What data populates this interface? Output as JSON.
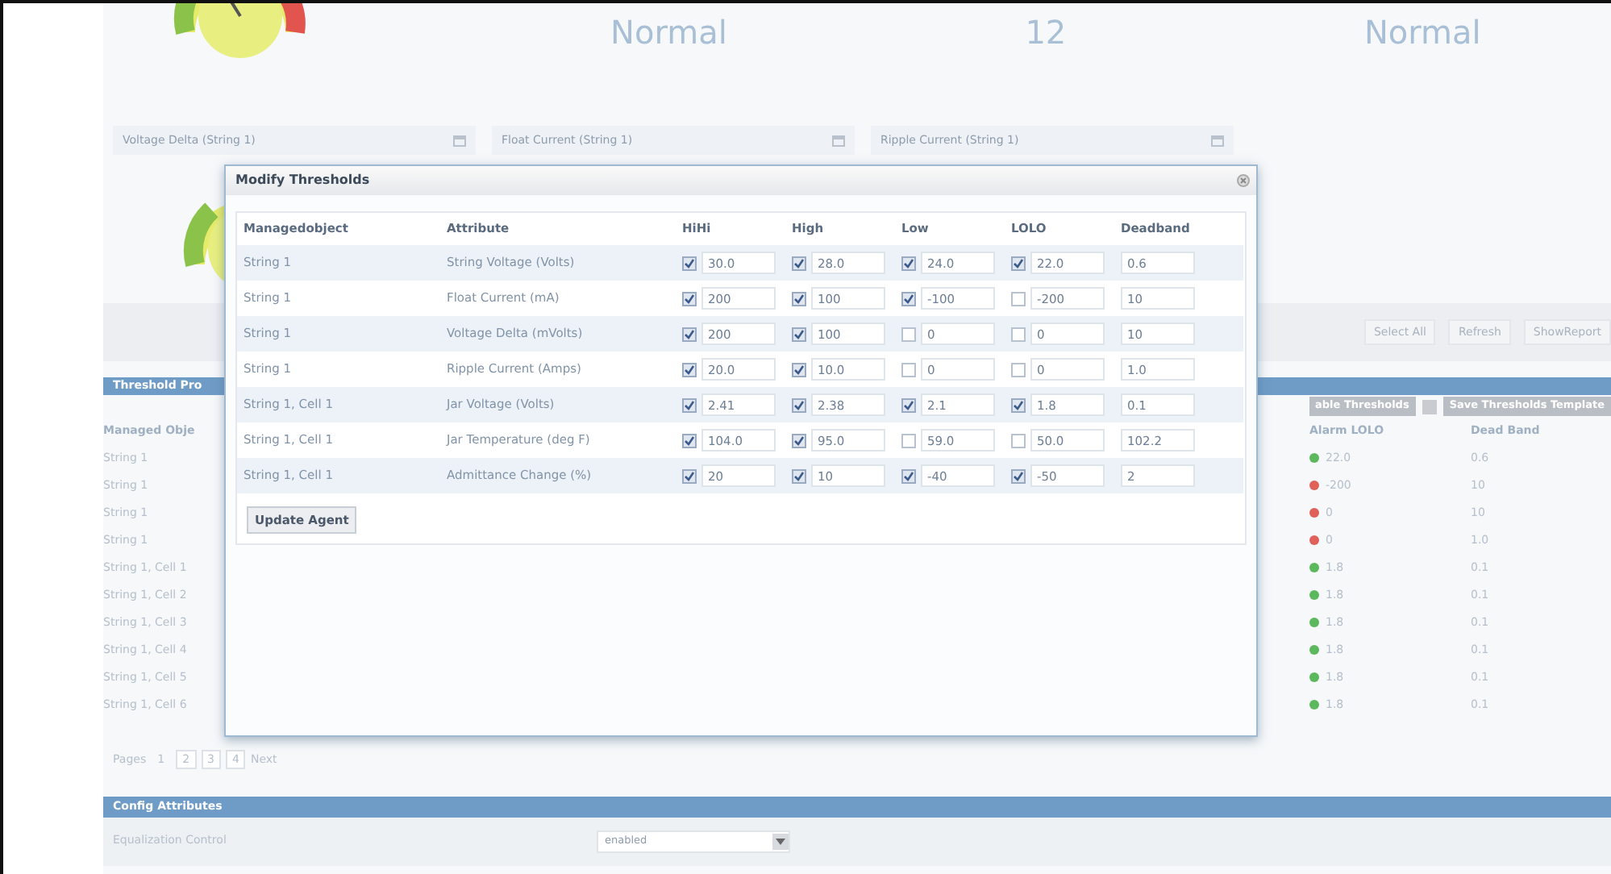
{
  "summary": [
    "Normal",
    "12",
    "Normal"
  ],
  "date_fields": [
    {
      "value": "Voltage Delta (String 1)"
    },
    {
      "value": "Float Current (String 1)"
    },
    {
      "value": "Ripple Current (String 1)"
    }
  ],
  "toolbar": {
    "buttons": [
      "Select All",
      "Refresh",
      "ShowReport"
    ]
  },
  "threshold_panel": {
    "title": "Threshold Pro",
    "actions": [
      "able Thresholds",
      "Save Thresholds Template"
    ],
    "columns": [
      "Managed Obje",
      "Alarm LOLO",
      "Dead Band"
    ],
    "rows": [
      {
        "object": "String 1",
        "alarm": "22.0",
        "color": "#5cb85c",
        "dead_band": "0.6"
      },
      {
        "object": "String 1",
        "alarm": "-200",
        "color": "#e0605a",
        "dead_band": "10"
      },
      {
        "object": "String 1",
        "alarm": "0",
        "color": "#e0605a",
        "dead_band": "10"
      },
      {
        "object": "String 1",
        "alarm": "0",
        "color": "#e0605a",
        "dead_band": "1.0"
      },
      {
        "object": "String 1, Cell 1",
        "alarm": "1.8",
        "color": "#5cb85c",
        "dead_band": "0.1"
      },
      {
        "object": "String 1, Cell 2",
        "alarm": "1.8",
        "color": "#5cb85c",
        "dead_band": "0.1"
      },
      {
        "object": "String 1, Cell 3",
        "alarm": "1.8",
        "color": "#5cb85c",
        "dead_band": "0.1"
      },
      {
        "object": "String 1, Cell 4",
        "alarm": "1.8",
        "color": "#5cb85c",
        "dead_band": "0.1"
      },
      {
        "object": "String 1, Cell 5",
        "alarm": "1.8",
        "color": "#5cb85c",
        "dead_band": "0.1"
      },
      {
        "object": "String 1, Cell 6",
        "alarm": "1.8",
        "color": "#5cb85c",
        "dead_band": "0.1"
      }
    ],
    "pager": {
      "label": "Pages",
      "pages": [
        {
          "label": "1",
          "selected": true
        },
        {
          "label": "2",
          "selected": false
        },
        {
          "label": "3",
          "selected": false
        },
        {
          "label": "4",
          "selected": false
        }
      ],
      "next": "Next"
    }
  },
  "config": {
    "title": "Config Attributes",
    "fields": [
      {
        "label": "Equalization Control",
        "value": "enabled"
      }
    ]
  },
  "dialog": {
    "title": "Modify Thresholds",
    "columns": [
      "Managedobject",
      "Attribute",
      "HiHi",
      "High",
      "Low",
      "LOLO",
      "Deadband"
    ],
    "rows": [
      {
        "object": "String 1",
        "attribute": "String Voltage (Volts)",
        "thresholds": [
          {
            "checked": true,
            "value": "30.0"
          },
          {
            "checked": true,
            "value": "28.0"
          },
          {
            "checked": true,
            "value": "24.0"
          },
          {
            "checked": true,
            "value": "22.0"
          }
        ],
        "deadband": "0.6"
      },
      {
        "object": "String 1",
        "attribute": "Float Current (mA)",
        "thresholds": [
          {
            "checked": true,
            "value": "200"
          },
          {
            "checked": true,
            "value": "100"
          },
          {
            "checked": true,
            "value": "-100"
          },
          {
            "checked": false,
            "value": "-200"
          }
        ],
        "deadband": "10"
      },
      {
        "object": "String 1",
        "attribute": "Voltage Delta (mVolts)",
        "thresholds": [
          {
            "checked": true,
            "value": "200"
          },
          {
            "checked": true,
            "value": "100"
          },
          {
            "checked": false,
            "value": "0"
          },
          {
            "checked": false,
            "value": "0"
          }
        ],
        "deadband": "10"
      },
      {
        "object": "String 1",
        "attribute": "Ripple Current (Amps)",
        "thresholds": [
          {
            "checked": true,
            "value": "20.0"
          },
          {
            "checked": true,
            "value": "10.0"
          },
          {
            "checked": false,
            "value": "0"
          },
          {
            "checked": false,
            "value": "0"
          }
        ],
        "deadband": "1.0"
      },
      {
        "object": "String 1, Cell 1",
        "attribute": "Jar Voltage (Volts)",
        "thresholds": [
          {
            "checked": true,
            "value": "2.41"
          },
          {
            "checked": true,
            "value": "2.38"
          },
          {
            "checked": true,
            "value": "2.1"
          },
          {
            "checked": true,
            "value": "1.8"
          }
        ],
        "deadband": "0.1"
      },
      {
        "object": "String 1, Cell 1",
        "attribute": "Jar Temperature (deg F)",
        "thresholds": [
          {
            "checked": true,
            "value": "104.0"
          },
          {
            "checked": true,
            "value": "95.0"
          },
          {
            "checked": false,
            "value": "59.0"
          },
          {
            "checked": false,
            "value": "50.0"
          }
        ],
        "deadband": "102.2"
      },
      {
        "object": "String 1, Cell 1",
        "attribute": "Admittance Change (%)",
        "thresholds": [
          {
            "checked": true,
            "value": "20"
          },
          {
            "checked": true,
            "value": "10"
          },
          {
            "checked": true,
            "value": "-40"
          },
          {
            "checked": true,
            "value": "-50"
          }
        ],
        "deadband": "2"
      }
    ],
    "button": "Update Agent"
  }
}
